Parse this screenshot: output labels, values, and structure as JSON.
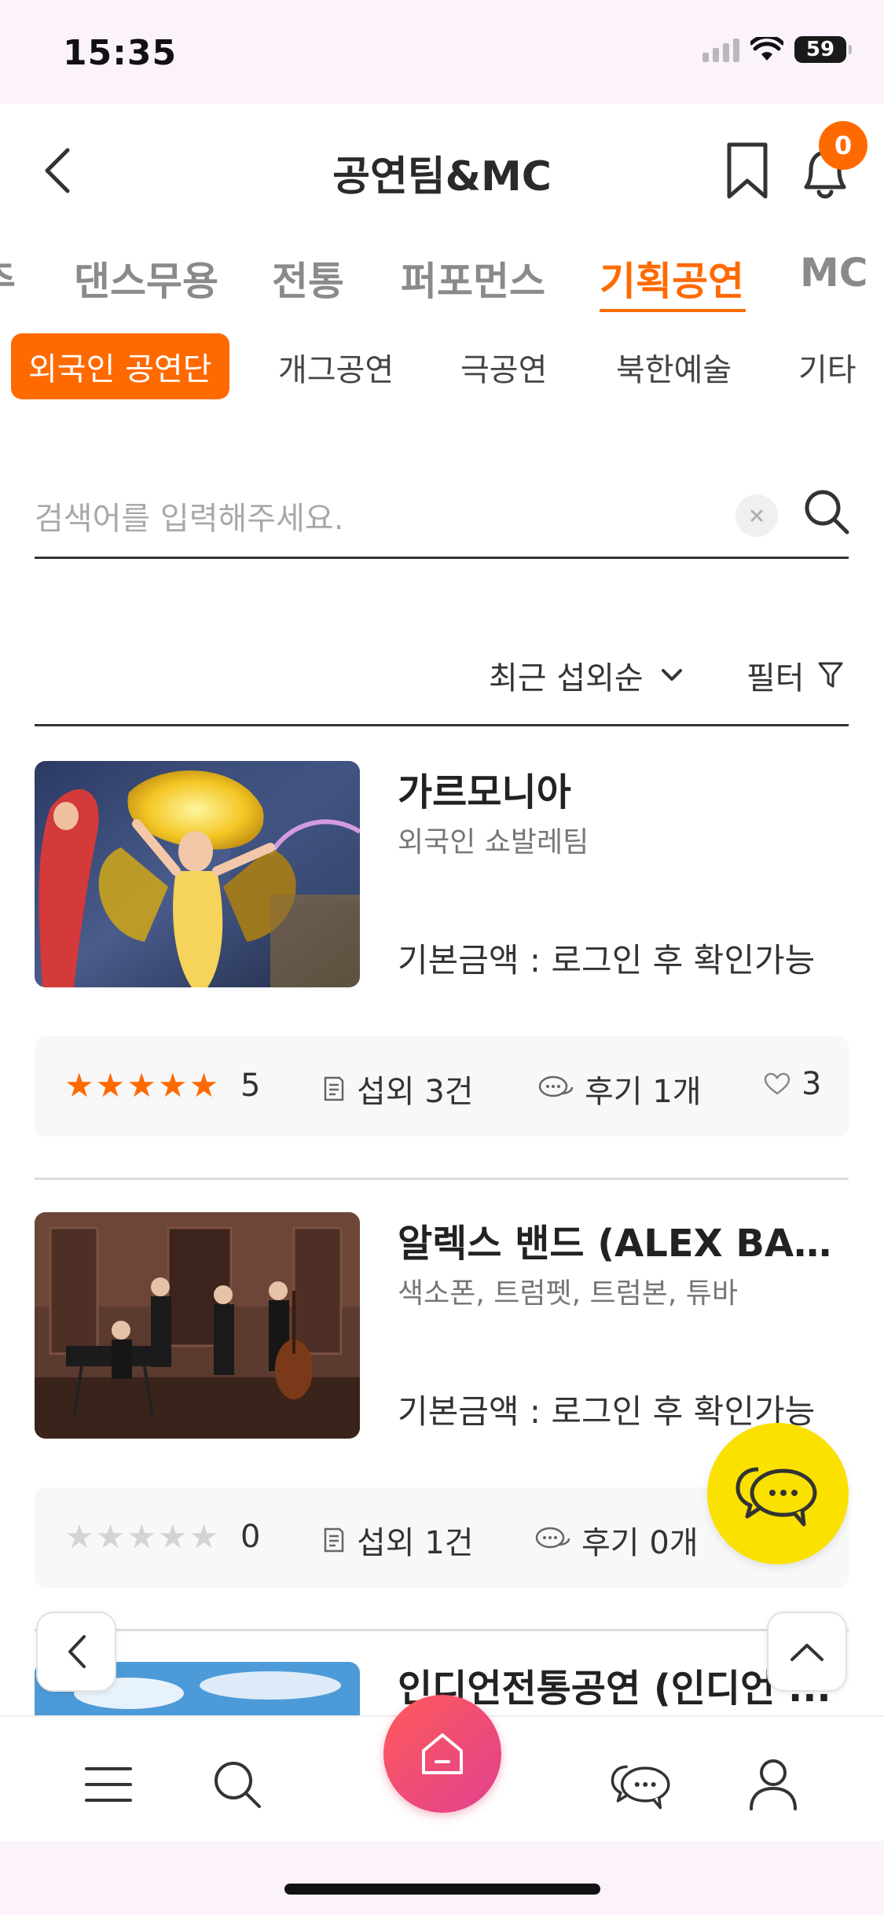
{
  "status_bar": {
    "time": "15:35",
    "battery": "59"
  },
  "header": {
    "title": "공연팀&MC",
    "notification_count": "0"
  },
  "category_tabs": [
    {
      "label": "주",
      "active": false
    },
    {
      "label": "댄스무용",
      "active": false
    },
    {
      "label": "전통",
      "active": false
    },
    {
      "label": "퍼포먼스",
      "active": false
    },
    {
      "label": "기획공연",
      "active": true
    },
    {
      "label": "MC",
      "active": false
    }
  ],
  "sub_tabs": [
    {
      "label": "외국인 공연단",
      "active": true
    },
    {
      "label": "개그공연",
      "active": false
    },
    {
      "label": "극공연",
      "active": false
    },
    {
      "label": "북한예술",
      "active": false
    },
    {
      "label": "기타",
      "active": false
    }
  ],
  "search": {
    "placeholder": "검색어를 입력해주세요.",
    "value": ""
  },
  "sort": {
    "label": "최근 섭외순"
  },
  "filter": {
    "label": "필터"
  },
  "items": [
    {
      "title": "가르모니아",
      "subtitle": "외국인 쇼발레팀",
      "price": "기본금액 : 로그인 후 확인가능",
      "rating": "5",
      "stars_filled": 5,
      "bookings": "섭외 3건",
      "reviews": "후기 1개",
      "likes": "3"
    },
    {
      "title": "알렉스 밴드 (ALEX BAND)",
      "subtitle": "색소폰, 트럼펫, 트럼본, 튜바",
      "price": "기본금액 : 로그인 후 확인가능",
      "rating": "0",
      "stars_filled": 0,
      "bookings": "섭외 1건",
      "reviews": "후기 0개",
      "likes": ""
    },
    {
      "title": "인디언전통공연 (인디언 ...",
      "subtitle": "",
      "price": "",
      "rating": "",
      "stars_filled": 0,
      "bookings": "",
      "reviews": "",
      "likes": ""
    }
  ],
  "icons": {
    "back": "chevron-left-icon",
    "bookmark": "bookmark-icon",
    "bell": "bell-icon",
    "search": "search-icon",
    "clear": "close-icon",
    "sort": "chevron-down-icon",
    "filter": "filter-icon",
    "chat": "chat-icon",
    "menu": "menu-icon",
    "home": "home-icon",
    "user": "user-icon"
  },
  "colors": {
    "accent": "#ff6a00",
    "chat_button": "#fae100",
    "home_gradient_start": "#ff5a5a",
    "home_gradient_end": "#e0418f"
  }
}
